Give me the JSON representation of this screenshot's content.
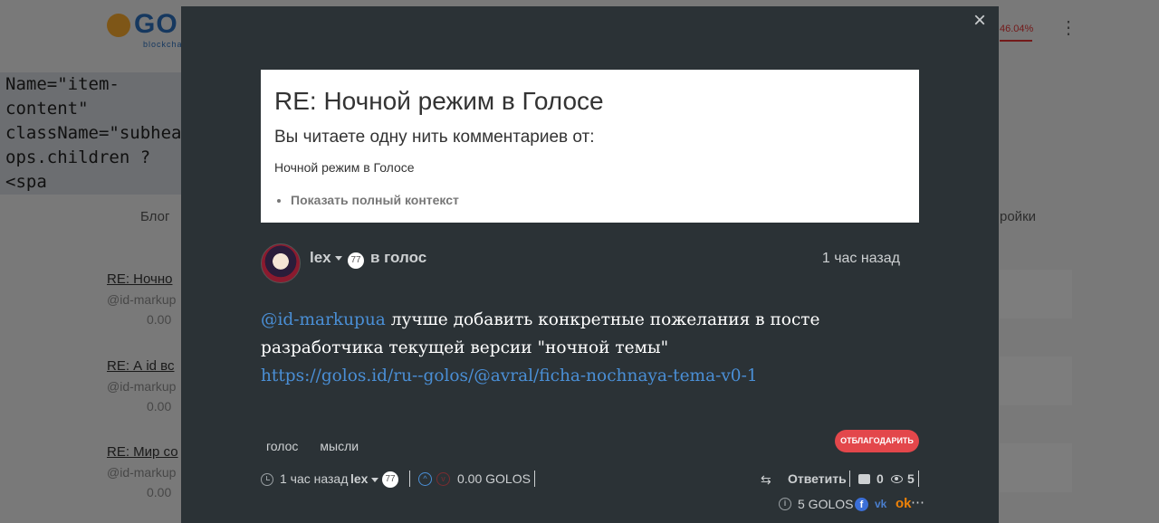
{
  "background": {
    "logo_text": "GO",
    "logo_sub": "blockchain",
    "code_lines": [
      "Name=\"item-content\"",
      "className=\"subhead\"",
      "ops.children ? <spa"
    ],
    "nav_left": "Блог",
    "nav_right": "ройки",
    "balance": "46.04%",
    "items": [
      {
        "title": "RE: Ночно",
        "author": "@id-markup",
        "value": "0.00"
      },
      {
        "title": "RE: А id вс",
        "author": "@id-markup",
        "value": "0.00"
      },
      {
        "title": "RE: Мир со",
        "author": "@id-markup",
        "value": "0.00"
      }
    ]
  },
  "modal": {
    "close_label": "×",
    "thread": {
      "title": "RE: Ночной режим в Голосе",
      "subtitle": "Вы читаете одну нить комментариев от:",
      "parent_title": "Ночной режим в Голосе",
      "show_context": "Показать полный контекст"
    },
    "post": {
      "author": "lex",
      "reputation": "77",
      "category": "в голос",
      "time": "1 час назад",
      "mention": "@id-markupua",
      "body_text": " лучше добавить конкретные пожелания в посте разработчика текущей версии \"ночной темы\"",
      "link": "https://golos.id/ru--golos/@avral/ficha-nochnaya-tema-v0-1"
    },
    "tags": [
      "голос",
      "мысли"
    ],
    "thank_button": "ОТБЛАГОДАРИТЬ",
    "footer": {
      "time": "1 час назад",
      "author": "lex",
      "reputation": "77",
      "amount": "0.00 GOLOS",
      "reply_label": "Ответить",
      "comments": "0",
      "views": "5",
      "payout": "5 GOLOS"
    }
  }
}
